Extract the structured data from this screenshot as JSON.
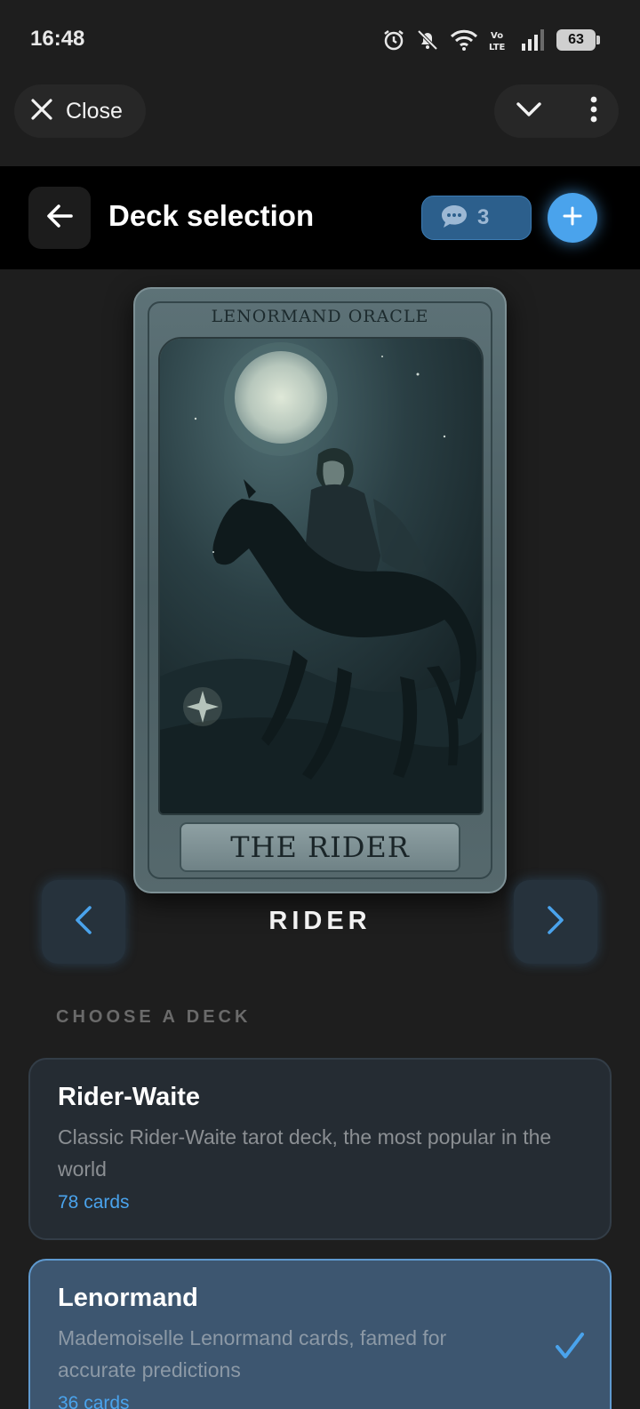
{
  "status": {
    "time": "16:48",
    "battery": "63",
    "net_label": "Vo\nLTE"
  },
  "top_bar": {
    "close_label": "Close"
  },
  "header": {
    "title": "Deck selection",
    "comments_count": "3"
  },
  "card": {
    "deck_name": "LENORMAND ORACLE",
    "plaque": "THE RIDER",
    "caption": "RIDER"
  },
  "section": {
    "label": "CHOOSE A DECK"
  },
  "decks": [
    {
      "name": "Rider-Waite",
      "description": "Classic Rider-Waite tarot deck, the most popular in the world",
      "count": "78 cards",
      "selected": false
    },
    {
      "name": "Lenormand",
      "description": "Mademoiselle Lenormand cards, famed for accurate predictions",
      "count": "36 cards",
      "selected": true
    }
  ],
  "colors": {
    "accent": "#4aa3ec",
    "selected_bg": "#3d5670",
    "header_bg": "#000000"
  }
}
